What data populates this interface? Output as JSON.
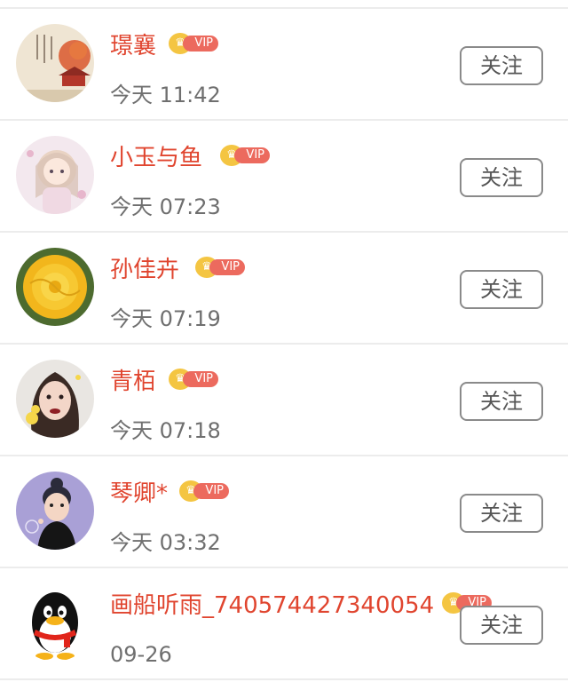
{
  "follow_label": "关注",
  "vip_label": "VIP",
  "accent": "#e0452f",
  "items": [
    {
      "name": "璟襄",
      "time": "今天 11:42",
      "avatar": "ink-painting-avatar",
      "vip": true
    },
    {
      "name": "小玉与鱼",
      "time": "今天 07:23",
      "avatar": "anime-girl-avatar",
      "vip": true
    },
    {
      "name": "孙佳卉",
      "time": "今天 07:19",
      "avatar": "yellow-rose-avatar",
      "vip": true
    },
    {
      "name": "青栢",
      "time": "今天 07:18",
      "avatar": "portrait-woman-avatar",
      "vip": true
    },
    {
      "name": "琴卿*",
      "time": "今天 03:32",
      "avatar": "cartoon-child-avatar",
      "vip": true
    },
    {
      "name": "画船听雨_740574427340054",
      "time": "09-26",
      "avatar": "penguin-avatar",
      "vip": true
    }
  ]
}
